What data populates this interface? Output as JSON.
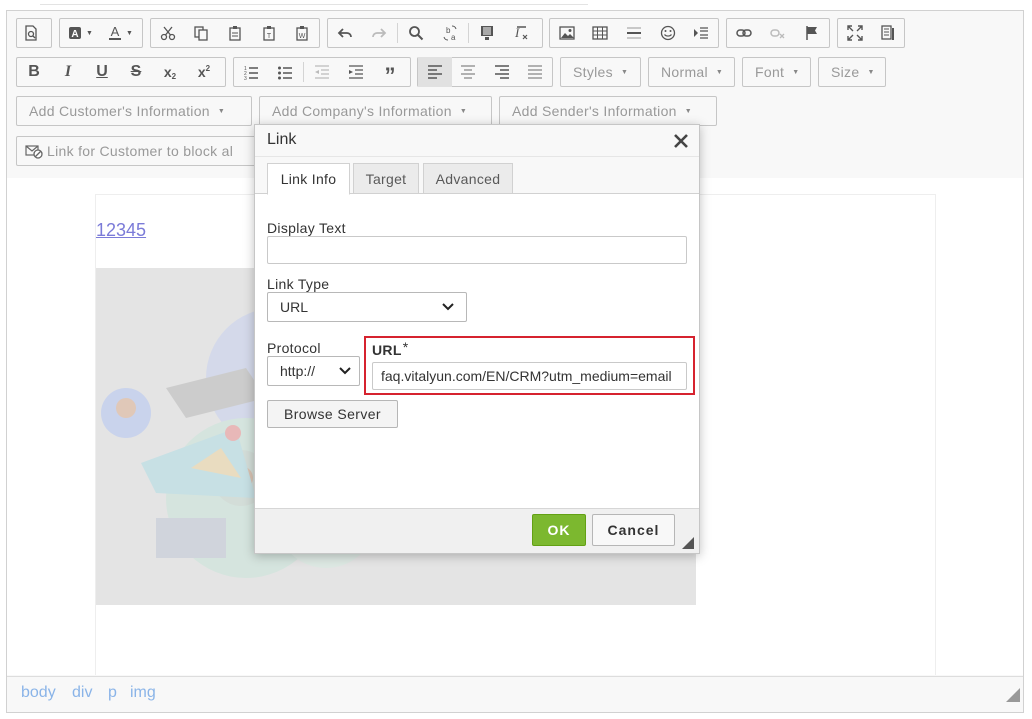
{
  "toolbar": {
    "styles_label": "Styles",
    "format_label": "Normal",
    "font_label": "Font",
    "size_label": "Size",
    "add_customer_info": "Add Customer's Information",
    "add_company_info": "Add Company's Information",
    "add_sender_info": "Add Sender's Information",
    "link_block_label": "Link for Customer to block al"
  },
  "document": {
    "link_text": "12345"
  },
  "statusbar": {
    "crumbs": [
      "body",
      "div",
      "p",
      "img"
    ]
  },
  "dialog": {
    "title": "Link",
    "tabs": [
      {
        "label": "Link Info",
        "selected": true
      },
      {
        "label": "Target",
        "selected": false
      },
      {
        "label": "Advanced",
        "selected": false
      }
    ],
    "display_text_label": "Display Text",
    "display_text_value": "",
    "link_type_label": "Link Type",
    "link_type_value": "URL",
    "protocol_label": "Protocol",
    "protocol_value": "http://",
    "url_label": "URL",
    "url_required_mark": "*",
    "url_value": "faq.vitalyun.com/EN/CRM?utm_medium=email",
    "browse_server_label": "Browse Server",
    "ok_label": "OK",
    "cancel_label": "Cancel"
  },
  "colors": {
    "ok_button": "#7cb82f",
    "highlight_border": "#d6232f",
    "link_color": "#7b7bd8"
  }
}
